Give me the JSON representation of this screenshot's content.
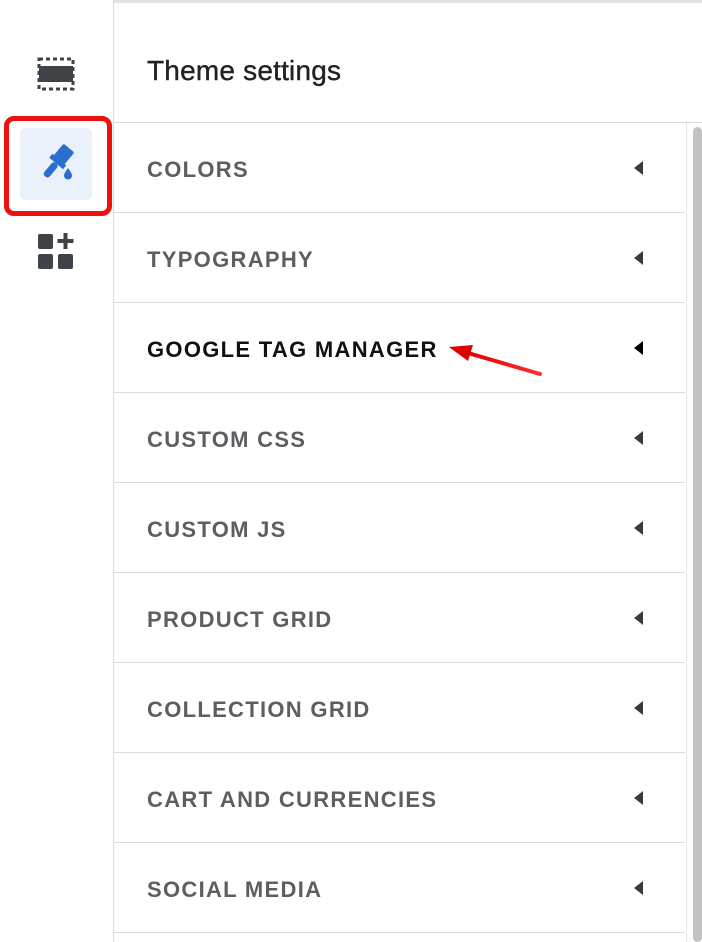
{
  "panel": {
    "title": "Theme settings"
  },
  "rail": {
    "items": [
      {
        "name": "sections",
        "icon": "sections-icon",
        "active": false
      },
      {
        "name": "theme-settings",
        "icon": "paint-brush-icon",
        "active": true
      },
      {
        "name": "apps",
        "icon": "add-block-icon",
        "active": false
      }
    ]
  },
  "settings": {
    "items": [
      {
        "label": "COLORS"
      },
      {
        "label": "TYPOGRAPHY"
      },
      {
        "label": "GOOGLE TAG MANAGER"
      },
      {
        "label": "CUSTOM CSS"
      },
      {
        "label": "CUSTOM JS"
      },
      {
        "label": "PRODUCT GRID"
      },
      {
        "label": "COLLECTION GRID"
      },
      {
        "label": "CART AND CURRENCIES"
      },
      {
        "label": "SOCIAL MEDIA"
      }
    ]
  },
  "colors": {
    "accent": "#2c6ecb",
    "highlight": "#ee1111",
    "active_bg": "#eaf1fb",
    "label": "#5c5f62"
  }
}
